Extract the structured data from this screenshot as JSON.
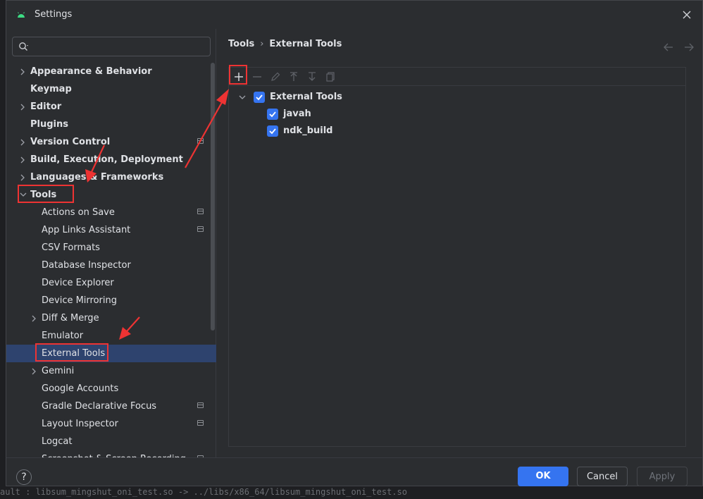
{
  "window": {
    "title": "Settings"
  },
  "search": {
    "placeholder": "",
    "value": ""
  },
  "sidebar": {
    "items": [
      {
        "label": "Appearance & Behavior",
        "bold": true,
        "expandable": true,
        "expanded": false,
        "indent": 0
      },
      {
        "label": "Keymap",
        "bold": true,
        "expandable": false,
        "indent": 0
      },
      {
        "label": "Editor",
        "bold": true,
        "expandable": true,
        "expanded": false,
        "indent": 0
      },
      {
        "label": "Plugins",
        "bold": true,
        "expandable": false,
        "indent": 0
      },
      {
        "label": "Version Control",
        "bold": true,
        "expandable": true,
        "expanded": false,
        "indent": 0,
        "project_icon": true
      },
      {
        "label": "Build, Execution, Deployment",
        "bold": true,
        "expandable": true,
        "expanded": false,
        "indent": 0
      },
      {
        "label": "Languages & Frameworks",
        "bold": true,
        "expandable": true,
        "expanded": false,
        "indent": 0
      },
      {
        "label": "Tools",
        "bold": true,
        "expandable": true,
        "expanded": true,
        "indent": 0
      },
      {
        "label": "Actions on Save",
        "bold": false,
        "expandable": false,
        "indent": 1,
        "project_icon": true
      },
      {
        "label": "App Links Assistant",
        "bold": false,
        "expandable": false,
        "indent": 1,
        "project_icon": true
      },
      {
        "label": "CSV Formats",
        "bold": false,
        "expandable": false,
        "indent": 1
      },
      {
        "label": "Database Inspector",
        "bold": false,
        "expandable": false,
        "indent": 1
      },
      {
        "label": "Device Explorer",
        "bold": false,
        "expandable": false,
        "indent": 1
      },
      {
        "label": "Device Mirroring",
        "bold": false,
        "expandable": false,
        "indent": 1
      },
      {
        "label": "Diff & Merge",
        "bold": false,
        "expandable": true,
        "expanded": false,
        "indent": 1
      },
      {
        "label": "Emulator",
        "bold": false,
        "expandable": false,
        "indent": 1
      },
      {
        "label": "External Tools",
        "bold": false,
        "expandable": false,
        "indent": 1,
        "selected": true
      },
      {
        "label": "Gemini",
        "bold": false,
        "expandable": true,
        "expanded": false,
        "indent": 1
      },
      {
        "label": "Google Accounts",
        "bold": false,
        "expandable": false,
        "indent": 1
      },
      {
        "label": "Gradle Declarative Focus",
        "bold": false,
        "expandable": false,
        "indent": 1,
        "project_icon": true
      },
      {
        "label": "Layout Inspector",
        "bold": false,
        "expandable": false,
        "indent": 1,
        "project_icon": true
      },
      {
        "label": "Logcat",
        "bold": false,
        "expandable": false,
        "indent": 1
      },
      {
        "label": "Screenshot & Screen Recording",
        "bold": false,
        "expandable": false,
        "indent": 1,
        "project_icon": true
      }
    ]
  },
  "breadcrumb": {
    "parent": "Tools",
    "separator": "›",
    "current": "External Tools"
  },
  "toolbar": {
    "buttons": [
      "add-icon",
      "remove-icon",
      "edit-icon",
      "move-up-icon",
      "move-down-icon",
      "copy-icon"
    ]
  },
  "tools_tree": {
    "group": {
      "label": "External Tools",
      "checked": true,
      "expanded": true
    },
    "children": [
      {
        "label": "javah",
        "checked": true
      },
      {
        "label": "ndk_build",
        "checked": true
      }
    ]
  },
  "footer": {
    "help_label": "?",
    "ok_label": "OK",
    "cancel_label": "Cancel",
    "apply_label": "Apply"
  },
  "background_terminal": {
    "line": "ault      : libsum_mingshut_oni_test.so -> ../libs/x86_64/libsum_mingshut_oni_test.so"
  },
  "colors": {
    "accent": "#3574f0",
    "selection": "#2e436e",
    "annotation": "#ee3333",
    "dialog_bg": "#2b2d30"
  }
}
